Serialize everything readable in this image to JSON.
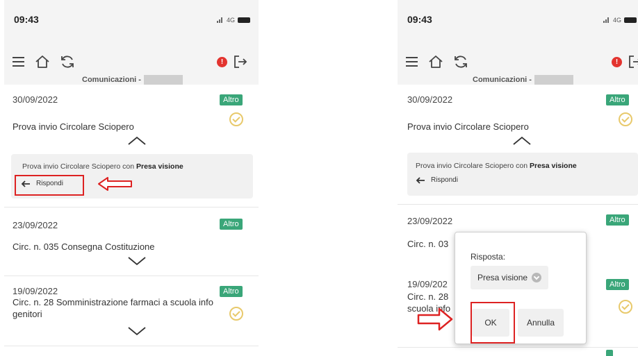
{
  "status": {
    "time": "09:43",
    "network": "4G"
  },
  "header": {
    "subtitle": "Comunicazioni -",
    "notification_count": "!"
  },
  "left": {
    "items": [
      {
        "date": "30/09/2022",
        "tag": "Altro",
        "title": "Prova invio Circolare Sciopero"
      },
      {
        "date": "23/09/2022",
        "tag": "Altro",
        "title": "Circ. n. 035 Consegna Costituzione"
      },
      {
        "date": "19/09/2022",
        "tag": "Altro",
        "title": "Circ. n. 28 Somministrazione farmaci a scuola info genitori"
      }
    ],
    "detail": {
      "text": "Prova invio Circolare Sciopero con ",
      "bold": "Presa visione",
      "reply_label": "Rispondi"
    }
  },
  "right": {
    "items": [
      {
        "date": "30/09/2022",
        "tag": "Altro",
        "title": "Prova invio Circolare Sciopero"
      },
      {
        "date": "23/09/2022",
        "tag": "Altro",
        "title": "Circ. n. 03"
      },
      {
        "date": "19/09/202",
        "tag": "Altro",
        "title_line1": "Circ. n. 28",
        "title_line2": "scuola info"
      }
    ],
    "detail": {
      "text": "Prova invio Circolare Sciopero con ",
      "bold": "Presa visione",
      "reply_label": "Rispondi"
    },
    "popup": {
      "label": "Risposta:",
      "selected": "Presa visione",
      "ok": "OK",
      "cancel": "Annulla"
    }
  },
  "colors": {
    "tag": "#3aa679",
    "highlight": "#dd2222",
    "badge": "#e3342f",
    "check": "#e8c96b"
  }
}
